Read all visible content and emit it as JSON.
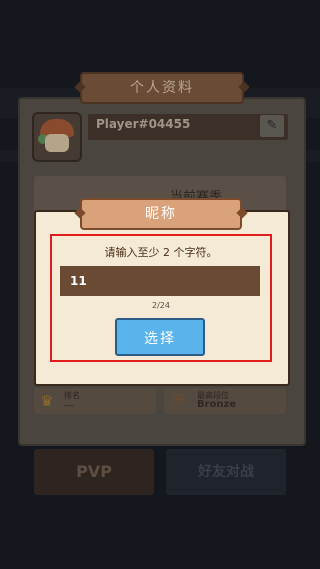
{
  "profile": {
    "title": "个人资料",
    "player_name": "Player#04455",
    "season_label": "当前赛季",
    "rank_label": "排名",
    "rank_value": "---",
    "trophy_label": "最高段位",
    "trophy_value": "Bronze"
  },
  "buttons": {
    "pvp": "PVP",
    "friend_battle": "好友对战"
  },
  "nickname_modal": {
    "title": "昵称",
    "prompt": "请输入至少 2 个字符。",
    "input_value": "11",
    "counter": "2/24",
    "confirm_label": "选择"
  },
  "colors": {
    "modal_bg": "#f4ead5",
    "input_bg": "#6b4a33",
    "button_blue": "#5ab3ea",
    "highlight_red": "#e01c1c"
  },
  "icons": {
    "edit": "pencil-icon",
    "rank": "crown-icon",
    "trophy": "shield-icon"
  }
}
